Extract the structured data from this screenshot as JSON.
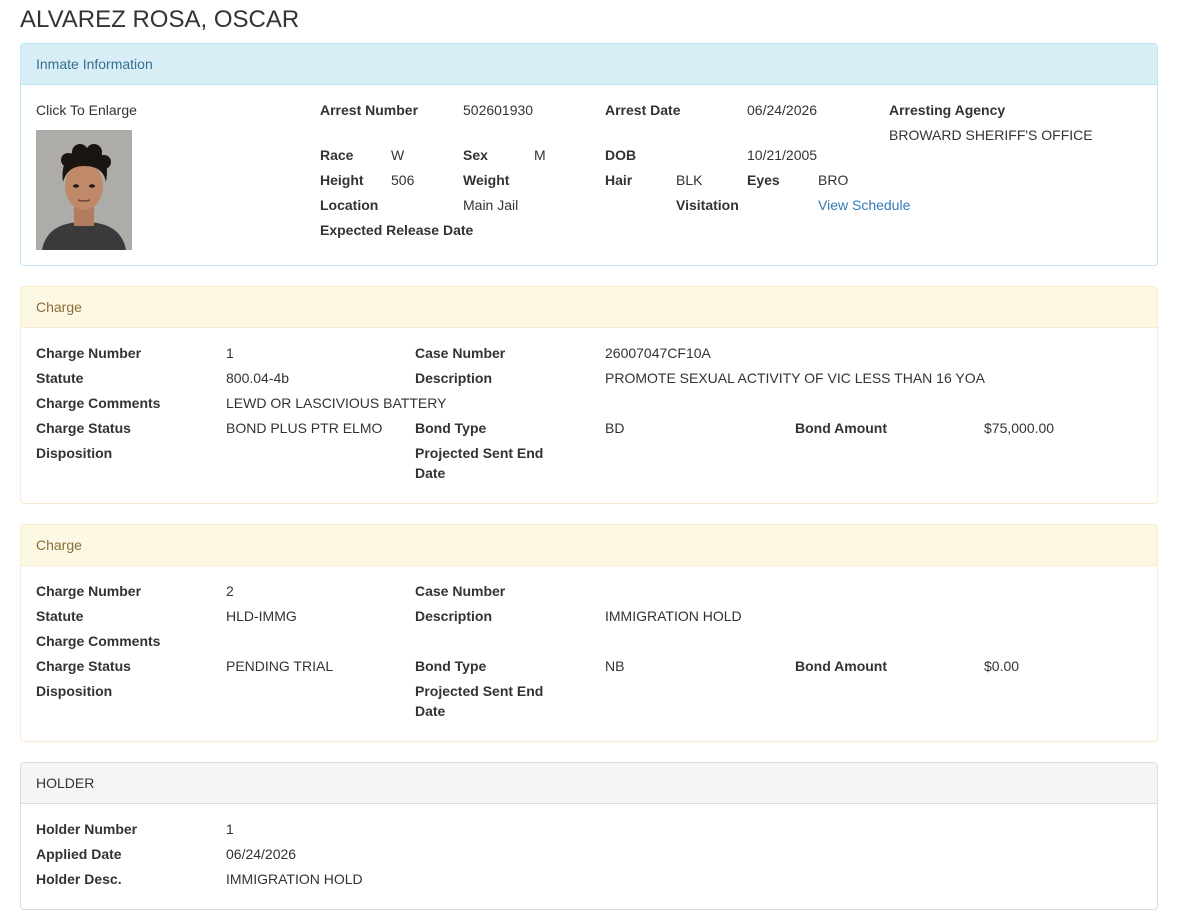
{
  "page": {
    "title": "ALVAREZ ROSA, OSCAR"
  },
  "inmate_info": {
    "heading": "Inmate Information",
    "click_to_enlarge": "Click To Enlarge",
    "arrest_number_label": "Arrest Number",
    "arrest_number": "502601930",
    "arrest_date_label": "Arrest Date",
    "arrest_date": "06/24/2026",
    "arresting_agency_label": "Arresting Agency",
    "arresting_agency": "BROWARD SHERIFF'S OFFICE",
    "race_label": "Race",
    "race": "W",
    "sex_label": "Sex",
    "sex": "M",
    "dob_label": "DOB",
    "dob": "10/21/2005",
    "height_label": "Height",
    "height": "506",
    "weight_label": "Weight",
    "hair_label": "Hair",
    "hair": "BLK",
    "eyes_label": "Eyes",
    "eyes": "BRO",
    "location_label": "Location",
    "location": "Main Jail",
    "visitation_label": "Visitation",
    "visitation_link": "View Schedule",
    "expected_release_label": "Expected Release Date"
  },
  "charges": [
    {
      "heading": "Charge",
      "charge_number_label": "Charge Number",
      "charge_number": "1",
      "case_number_label": "Case Number",
      "case_number": "26007047CF10A",
      "statute_label": "Statute",
      "statute": "800.04-4b",
      "description_label": "Description",
      "description": "PROMOTE SEXUAL ACTIVITY OF VIC LESS THAN 16 YOA",
      "charge_comments_label": "Charge Comments",
      "charge_comments": "LEWD OR LASCIVIOUS BATTERY",
      "charge_status_label": "Charge Status",
      "charge_status": "BOND PLUS PTR ELMO",
      "bond_type_label": "Bond Type",
      "bond_type": "BD",
      "bond_amount_label": "Bond Amount",
      "bond_amount": "$75,000.00",
      "disposition_label": "Disposition",
      "projected_label_line1": "Projected Sent End",
      "projected_label_line2": "Date"
    },
    {
      "heading": "Charge",
      "charge_number_label": "Charge Number",
      "charge_number": "2",
      "case_number_label": "Case Number",
      "case_number": "",
      "statute_label": "Statute",
      "statute": "HLD-IMMG",
      "description_label": "Description",
      "description": "IMMIGRATION HOLD",
      "charge_comments_label": "Charge Comments",
      "charge_comments": "",
      "charge_status_label": "Charge Status",
      "charge_status": "PENDING TRIAL",
      "bond_type_label": "Bond Type",
      "bond_type": "NB",
      "bond_amount_label": "Bond Amount",
      "bond_amount": "$0.00",
      "disposition_label": "Disposition",
      "projected_label_line1": "Projected Sent End",
      "projected_label_line2": "Date"
    }
  ],
  "holder": {
    "heading": "HOLDER",
    "holder_number_label": "Holder Number",
    "holder_number": "1",
    "applied_date_label": "Applied Date",
    "applied_date": "06/24/2026",
    "holder_desc_label": "Holder Desc.",
    "holder_desc": "IMMIGRATION HOLD"
  },
  "colors": {
    "info_heading_bg": "#d9edf7",
    "info_heading_text": "#31708f",
    "charge_heading_bg": "#fcf8e3",
    "charge_heading_text": "#8a6d3b",
    "holder_heading_bg": "#f5f5f5",
    "link": "#337ab7"
  },
  "icons": {
    "mugshot": "inmate-photo"
  }
}
